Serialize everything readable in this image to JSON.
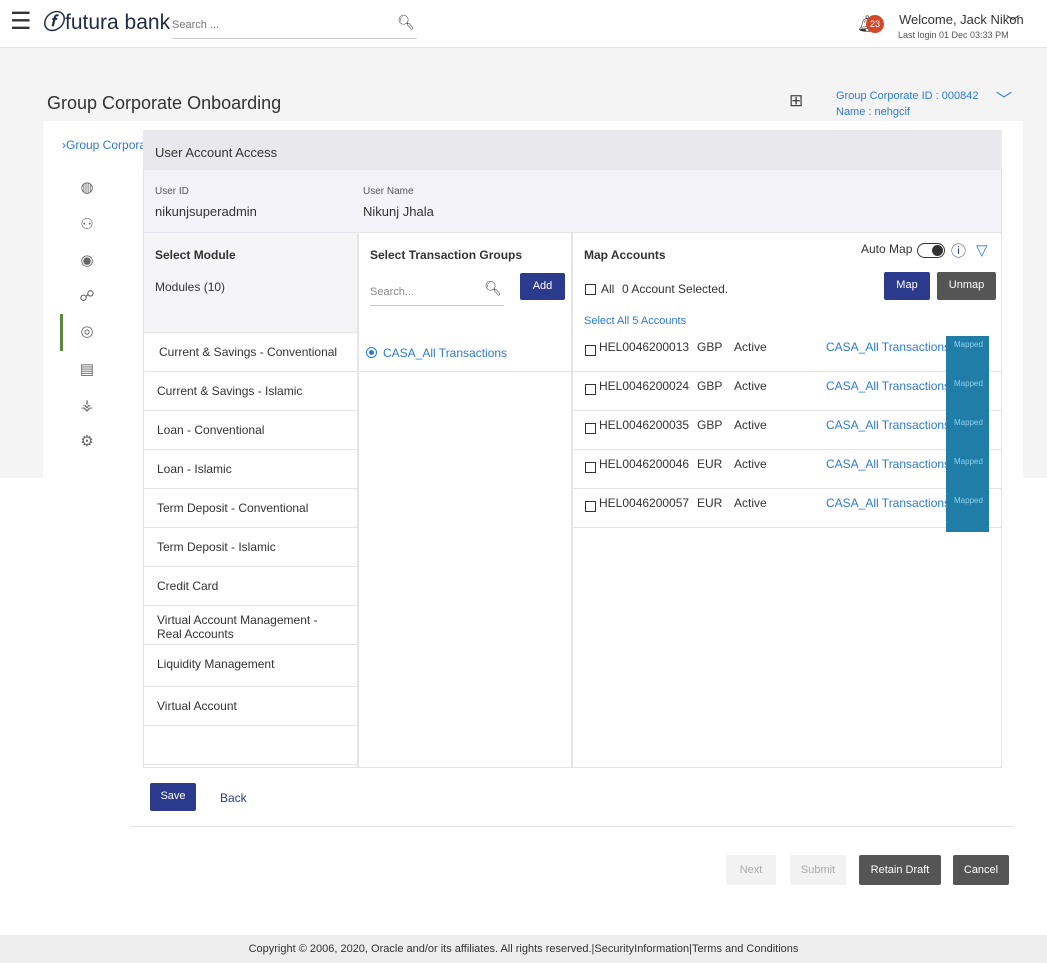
{
  "header": {
    "menu_icon": "hamburger-icon",
    "logo_mark": "ⓕ",
    "logo_text": "futura bank",
    "search_placeholder": "Search ...",
    "notification_count": "23",
    "welcome": "Welcome, Jack Nikon",
    "last_login": "Last login 01 Dec 03:33 PM"
  },
  "page": {
    "title": "Group Corporate Onboarding",
    "group_corporate_id": "Group Corporate ID : 000842",
    "group_corporate_name": "Name : nehgcif"
  },
  "rail": {
    "link": "Group Corporate",
    "icons": [
      "globe-icon",
      "users-settings-icon",
      "badge-icon",
      "group-icon",
      "touch-icon",
      "document-icon",
      "network-icon",
      "gears-icon"
    ]
  },
  "section": {
    "title": "User Account Access",
    "user_id_label": "User ID",
    "user_id": "nikunjsuperadmin",
    "user_name_label": "User Name",
    "user_name": "Nikunj Jhala"
  },
  "modules": {
    "header": "Select Module",
    "count": "Modules (10)",
    "items": [
      "Current & Savings - Conventional",
      "Current & Savings - Islamic",
      "Loan - Conventional",
      "Loan - Islamic",
      "Term Deposit - Conventional",
      "Term Deposit - Islamic",
      "Credit Card",
      "Virtual Account Management - Real Accounts",
      "Liquidity Management",
      "Virtual Account"
    ]
  },
  "transactions": {
    "header": "Select Transaction Groups",
    "search_placeholder": "Search...",
    "add_label": "Add",
    "selected_group": "CASA_All Transactions"
  },
  "accounts": {
    "header": "Map Accounts",
    "auto_map_label": "Auto Map",
    "all_label": "All",
    "selected_text": "0 Account Selected.",
    "map_label": "Map",
    "unmap_label": "Unmap",
    "select_all_link": "Select All 5 Accounts",
    "rows": [
      {
        "account": "HEL0046200013",
        "currency": "GBP",
        "status": "Active",
        "group": "CASA_All Transactions",
        "tag": "Mapped"
      },
      {
        "account": "HEL0046200024",
        "currency": "GBP",
        "status": "Active",
        "group": "CASA_All Transactions",
        "tag": "Mapped"
      },
      {
        "account": "HEL0046200035",
        "currency": "GBP",
        "status": "Active",
        "group": "CASA_All Transactions",
        "tag": "Mapped"
      },
      {
        "account": "HEL0046200046",
        "currency": "EUR",
        "status": "Active",
        "group": "CASA_All Transactions",
        "tag": "Mapped"
      },
      {
        "account": "HEL0046200057",
        "currency": "EUR",
        "status": "Active",
        "group": "CASA_All Transactions",
        "tag": "Mapped"
      }
    ]
  },
  "actions": {
    "save": "Save",
    "back": "Back",
    "next": "Next",
    "submit": "Submit",
    "retain_draft": "Retain Draft",
    "cancel": "Cancel"
  },
  "footer": {
    "copyright": "Copyright © 2006, 2020, Oracle and/or its affiliates. All rights reserved.|SecurityInformation|Terms and Conditions"
  }
}
